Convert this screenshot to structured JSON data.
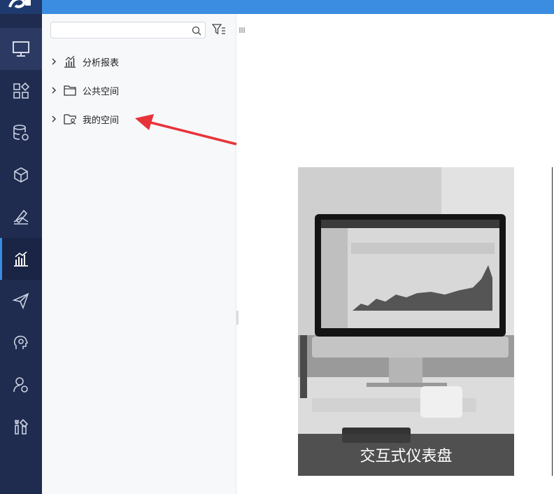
{
  "sidebar": {
    "search": {
      "placeholder": "",
      "value": ""
    },
    "tree": [
      {
        "label": "分析报表",
        "icon": "bar-chart-icon"
      },
      {
        "label": "公共空间",
        "icon": "folder-icon"
      },
      {
        "label": "我的空间",
        "icon": "user-folder-icon"
      }
    ]
  },
  "nav_rail": [
    {
      "icon": "desktop-icon"
    },
    {
      "icon": "widgets-icon"
    },
    {
      "icon": "database-settings-icon"
    },
    {
      "icon": "cube-icon"
    },
    {
      "icon": "pen-edit-icon"
    },
    {
      "icon": "chart-analysis-icon",
      "selected": true
    },
    {
      "icon": "send-icon"
    },
    {
      "icon": "head-settings-icon"
    },
    {
      "icon": "user-settings-icon"
    },
    {
      "icon": "tools-icon"
    }
  ],
  "main": {
    "card": {
      "caption": "交互式仪表盘"
    }
  },
  "colors": {
    "topbar": "#3a8de0",
    "rail": "#1f2b4f",
    "annotation_arrow": "#e8333a"
  }
}
